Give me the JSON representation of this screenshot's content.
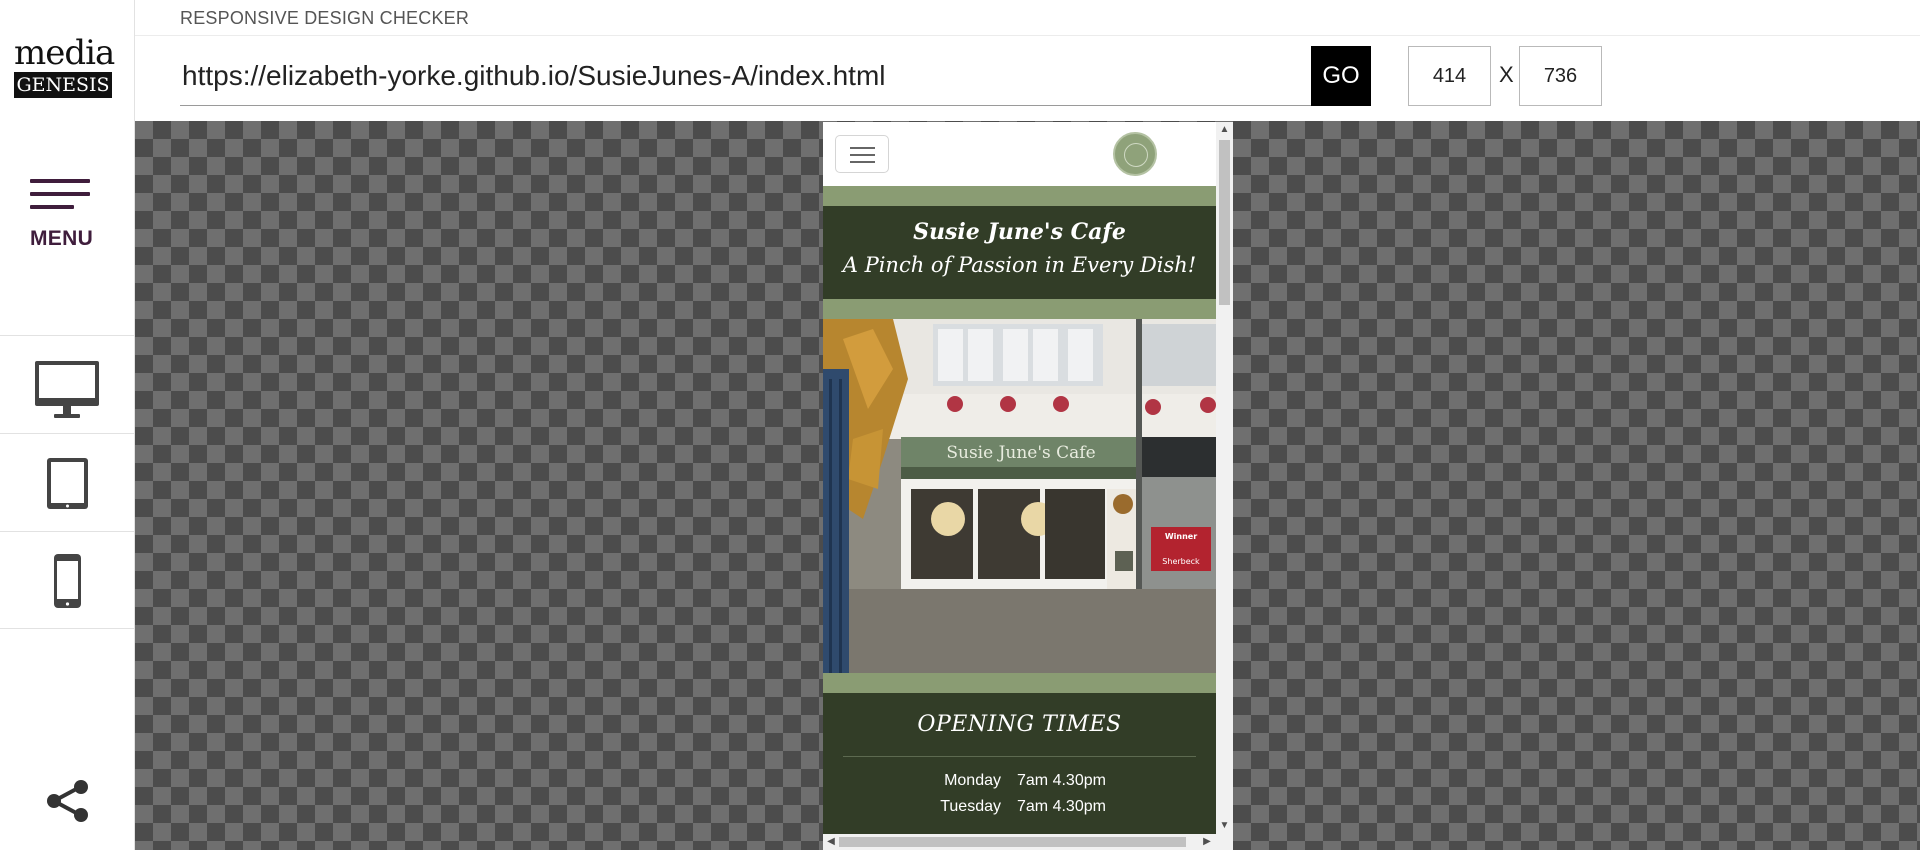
{
  "app": {
    "title": "RESPONSIVE DESIGN CHECKER",
    "logo": {
      "line1": "media",
      "line2": "GENESIS"
    }
  },
  "sidebar": {
    "menu_label": "MENU",
    "devices": [
      {
        "name": "desktop",
        "icon": "desktop-monitor-icon"
      },
      {
        "name": "tablet",
        "icon": "tablet-icon"
      },
      {
        "name": "mobile",
        "icon": "mobile-phone-icon"
      }
    ],
    "share_icon": "share-icon"
  },
  "toolbar": {
    "url": "https://elizabeth-yorke.github.io/SusieJunes-A/index.html",
    "go_label": "GO",
    "width": "414",
    "height": "736",
    "separator": "X"
  },
  "site": {
    "title": "Susie June's Cafe",
    "tagline": "A Pinch of Passion in Every Dish!",
    "photo": {
      "sign": "Susie June's Cafe",
      "poster_line1": "Winner",
      "poster_line2": "Sherbeck"
    },
    "hours_title": "OPENING TIMES",
    "hours": [
      {
        "day": "Monday",
        "time": "7am 4.30pm"
      },
      {
        "day": "Tuesday",
        "time": "7am 4.30pm"
      }
    ]
  },
  "colors": {
    "brand_purple": "#3f1d3c",
    "site_dark_green": "#323d27",
    "site_sage": "#8a9c73",
    "go_button": "#000000"
  }
}
